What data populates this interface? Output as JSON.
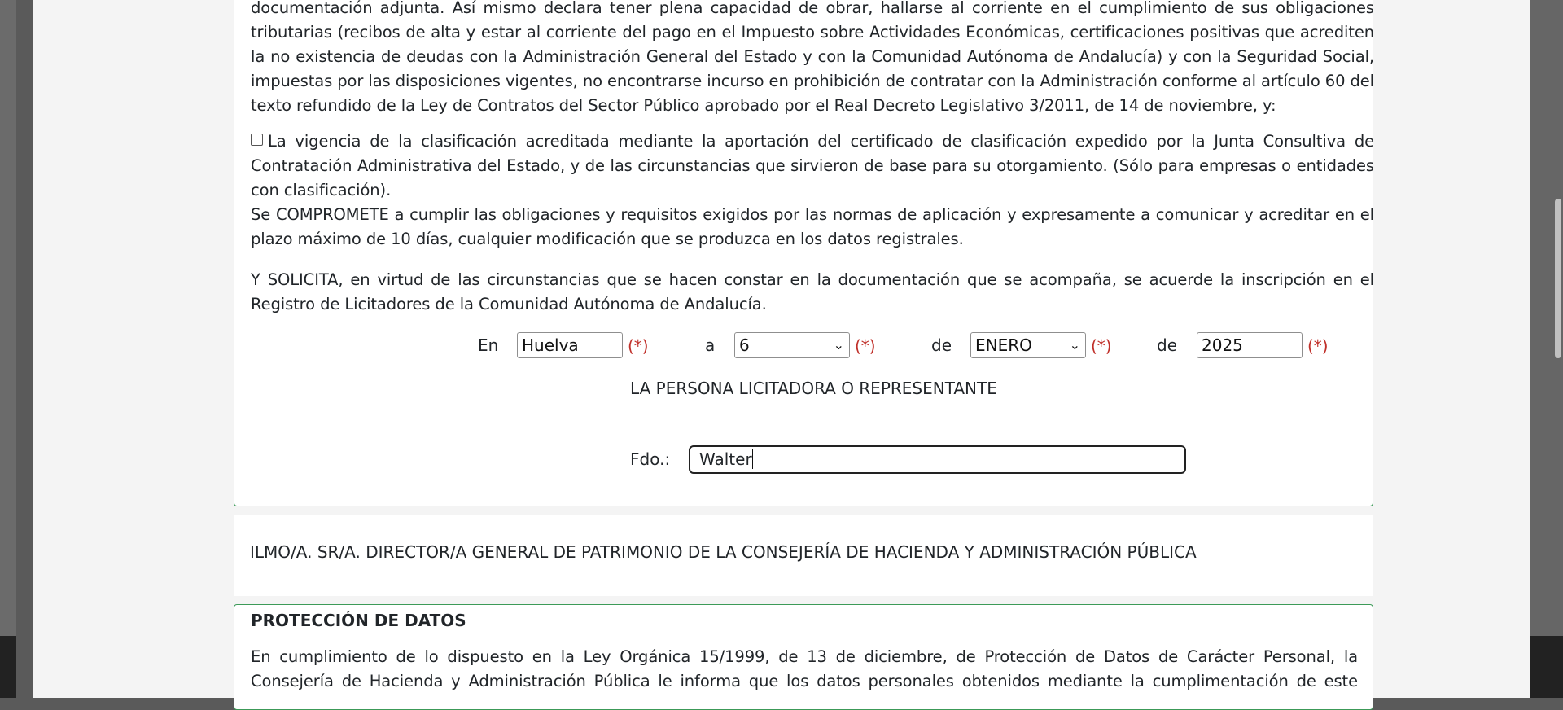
{
  "main": {
    "para1": "documentación adjunta. Así mismo declara tener plena capacidad de obrar, hallarse al corriente en el cumplimiento de sus obligaciones tributarias (recibos de alta y estar al corriente del pago en el Impuesto sobre Actividades Económicas, certificaciones positivas que acrediten la no existencia de deudas con la Administración General del Estado y con la Comunidad Autónoma de Andalucía) y con la Seguridad Social, impuestas por las disposiciones vigentes, no encontrarse incurso en prohibición de contratar con la Administración conforme al artículo 60 del texto refundido de la Ley de Contratos del Sector Público aprobado por el Real Decreto Legislativo 3/2011, de 14 de noviembre, y:",
    "checkbox_text": "La vigencia de la clasificación acreditada mediante la aportación del certificado de clasificación expedido por la Junta Consultiva de Contratación Administrativa del Estado, y de las circunstancias que sirvieron de base para su otorgamiento. (Sólo para empresas o entidades con clasificación).",
    "para_compromete": "Se COMPROMETE a cumplir las obligaciones y requisitos exigidos por las normas de aplicación y expresamente a comunicar y acreditar en el plazo máximo de 10 días, cualquier modificación que se produzca en los datos registrales.",
    "para_solicita": "Y SOLICITA, en virtud de las circunstancias que se hacen constar en la documentación que se acompaña, se acuerde la inscripción en el Registro de Licitadores de la Comunidad Autónoma de Andalucía.",
    "place_row": {
      "en_label": "En",
      "city_value": "Huelva",
      "a_label": "a",
      "day_value": "6",
      "de_label_1": "de",
      "month_value": "ENERO",
      "de_label_2": "de",
      "year_value": "2025",
      "required_marker": "(*)"
    },
    "signer_title": "LA PERSONA LICITADORA O REPRESENTANTE",
    "signature_label": "Fdo.:",
    "signature_value": "Walter"
  },
  "addressee": "ILMO/A. SR/A. DIRECTOR/A GENERAL DE PATRIMONIO DE LA CONSEJERÍA DE HACIENDA Y ADMINISTRACIÓN PÚBLICA",
  "data_protection": {
    "title": "PROTECCIÓN DE DATOS",
    "text": "En cumplimiento de lo dispuesto en la Ley Orgánica 15/1999, de 13 de diciembre, de Protección de Datos de Carácter Personal, la Consejería de Hacienda y Administración Pública le informa que los datos personales obtenidos mediante la cumplimentación de este"
  },
  "colors": {
    "border_green": "#3c9a58",
    "required_red": "#c0302a"
  },
  "icons": {
    "select_caret": "chevron-down-icon"
  }
}
